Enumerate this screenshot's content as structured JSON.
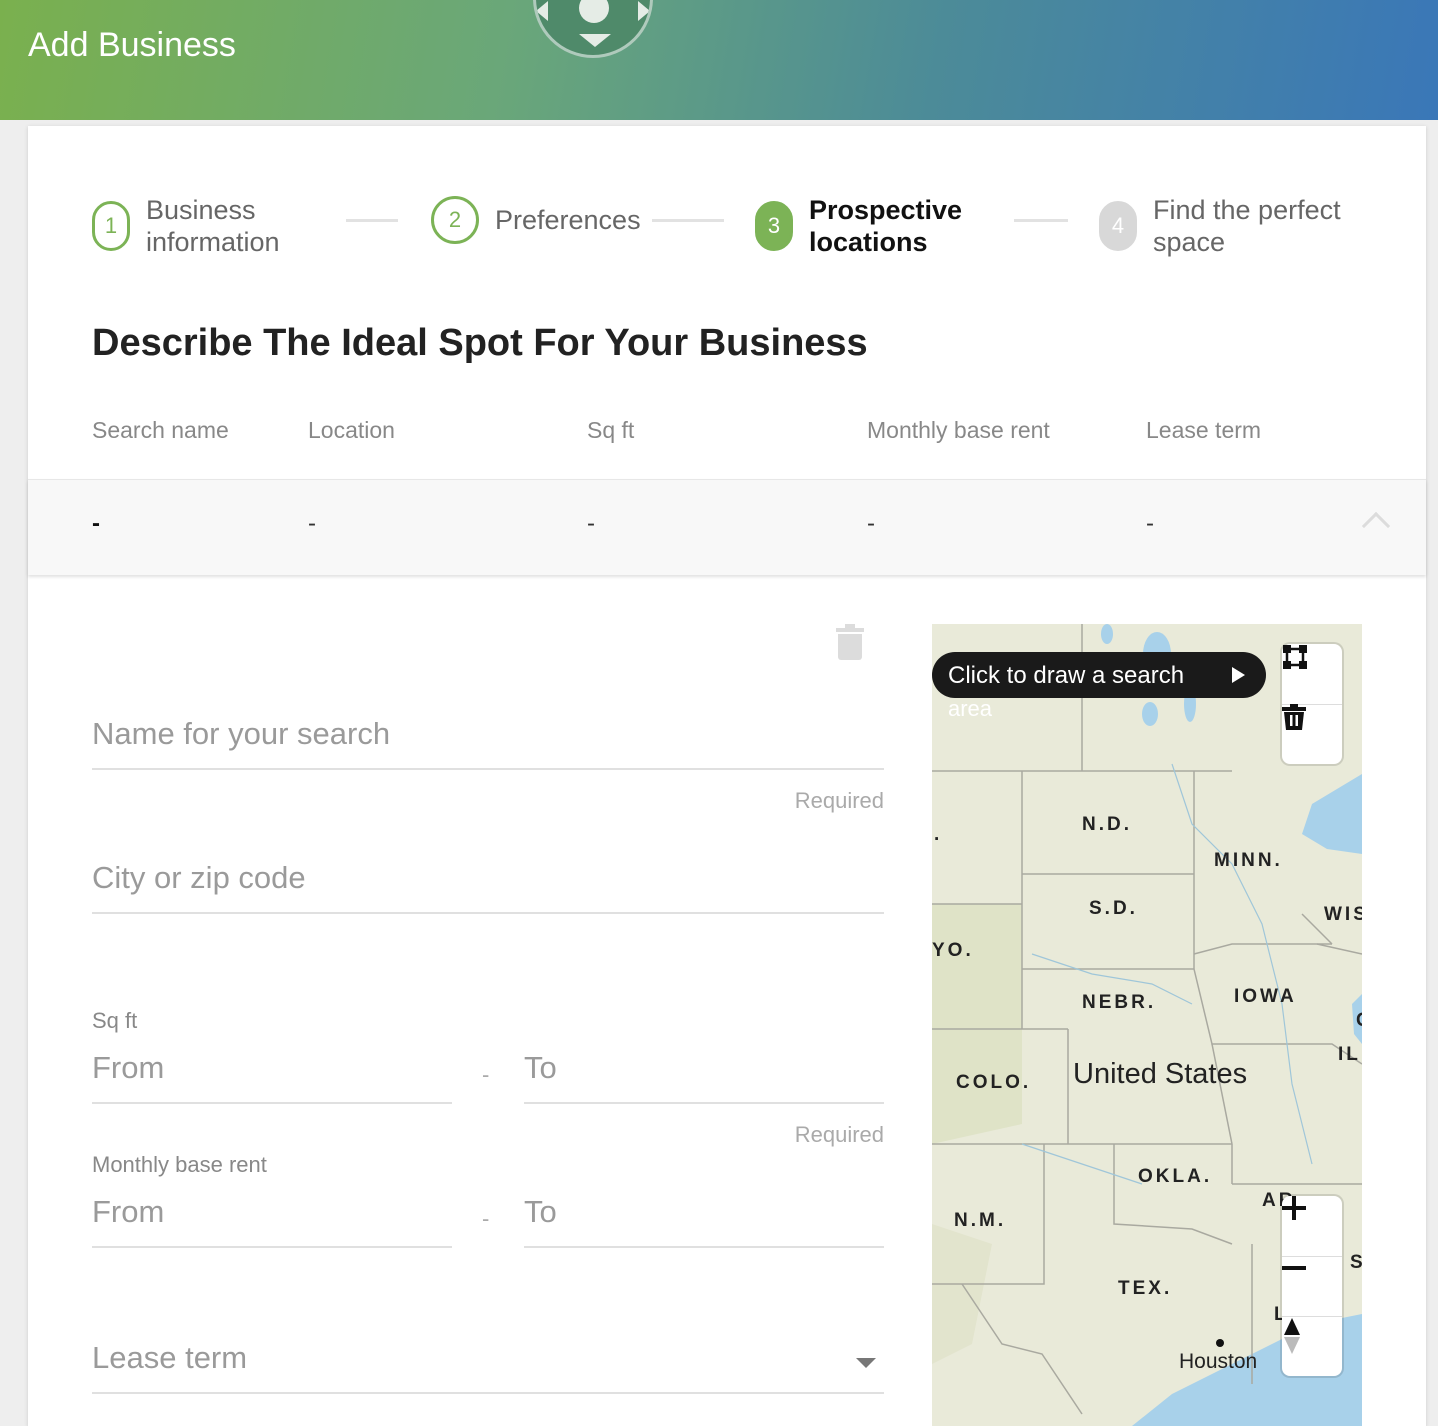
{
  "header": {
    "title": "Add Business"
  },
  "steps": [
    {
      "number": "1",
      "label": "Business information",
      "state": "done"
    },
    {
      "number": "2",
      "label": "Preferences",
      "state": "done"
    },
    {
      "number": "3",
      "label": "Prospective locations",
      "state": "active"
    },
    {
      "number": "4",
      "label": "Find the perfect space",
      "state": "pending"
    }
  ],
  "page": {
    "title": "Describe The Ideal Spot For Your Business"
  },
  "table": {
    "columns": [
      "Search name",
      "Location",
      "Sq ft",
      "Monthly base rent",
      "Lease term"
    ],
    "row": [
      "-",
      "-",
      "-",
      "-",
      "-"
    ]
  },
  "form": {
    "search_name": {
      "placeholder": "Name for your search",
      "helper": "Required"
    },
    "location": {
      "placeholder": "City or zip code"
    },
    "sqft": {
      "label": "Sq ft",
      "from_placeholder": "From",
      "to_placeholder": "To",
      "separator": "-",
      "helper": "Required"
    },
    "rent": {
      "label": "Monthly base rent",
      "from_placeholder": "From",
      "to_placeholder": "To",
      "separator": "-"
    },
    "lease": {
      "placeholder": "Lease term"
    }
  },
  "map": {
    "tooltip": "Click to draw a search",
    "tooltip_overflow": "area",
    "country_label": "United States",
    "city_label": "Houston",
    "state_labels": {
      "nd": "N.D.",
      "minn": "MINN.",
      "sd": "S.D.",
      "wis": "WIS",
      "wyo": "YO.",
      "nebr": "NEBR.",
      "iowa": "IOWA",
      "il": "IL",
      "colo": "COLO.",
      "okla": "OKLA.",
      "ark": "AR",
      "nm": "N.M.",
      "tex": "TEX.",
      "ms": "S",
      "la": "L",
      "edge_c": "C",
      "edge_dot": "."
    },
    "controls": [
      "draw-polygon",
      "trash",
      "zoom-in",
      "zoom-out",
      "compass"
    ]
  },
  "colors": {
    "accent": "#7cb356",
    "header_start": "#7ab04e",
    "header_end": "#3a77b8",
    "water": "#a8d1ea",
    "land": "#e9ead9"
  }
}
